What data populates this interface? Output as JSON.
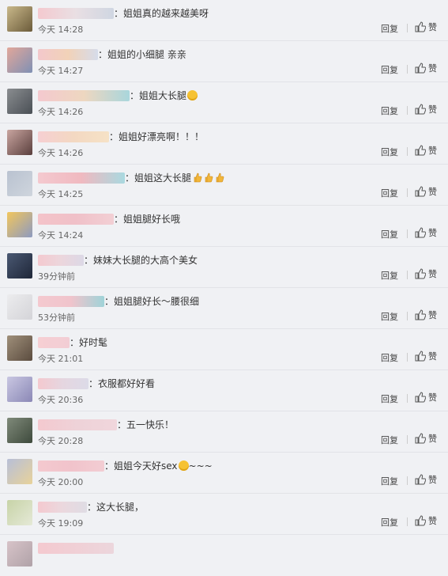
{
  "labels": {
    "reply": "回复",
    "like": "赞"
  },
  "comments": [
    {
      "text": "：姐姐真的越来越美呀",
      "time": "今天 14:28"
    },
    {
      "text": "：姐姐的小细腿 亲亲",
      "time": "今天 14:27"
    },
    {
      "text": "：姐姐大长腿",
      "time": "今天 14:26",
      "emoji": "surprised-emoji"
    },
    {
      "text": "：姐姐好漂亮啊！！！",
      "time": "今天 14:26"
    },
    {
      "text": "：姐姐这大长腿",
      "time": "今天 14:25",
      "emoji": "thumbs-up-emoji x3"
    },
    {
      "text": "：姐姐腿好长哦",
      "time": "今天 14:24"
    },
    {
      "text": "：妹妹大长腿的大高个美女",
      "time": "39分钟前"
    },
    {
      "text": "：姐姐腿好长～腰很细",
      "time": "53分钟前"
    },
    {
      "text": "：好时髦",
      "time": "今天 21:01"
    },
    {
      "text": "：衣服都好好看",
      "time": "今天 20:36"
    },
    {
      "text": "：五一快乐！",
      "time": "今天 20:28"
    },
    {
      "text": "：姐姐今天好sex",
      "text_after": "~~~",
      "time": "今天 20:00",
      "emoji": "smirk-emoji"
    },
    {
      "text": "：这大长腿，",
      "time": "今天 19:09"
    }
  ]
}
